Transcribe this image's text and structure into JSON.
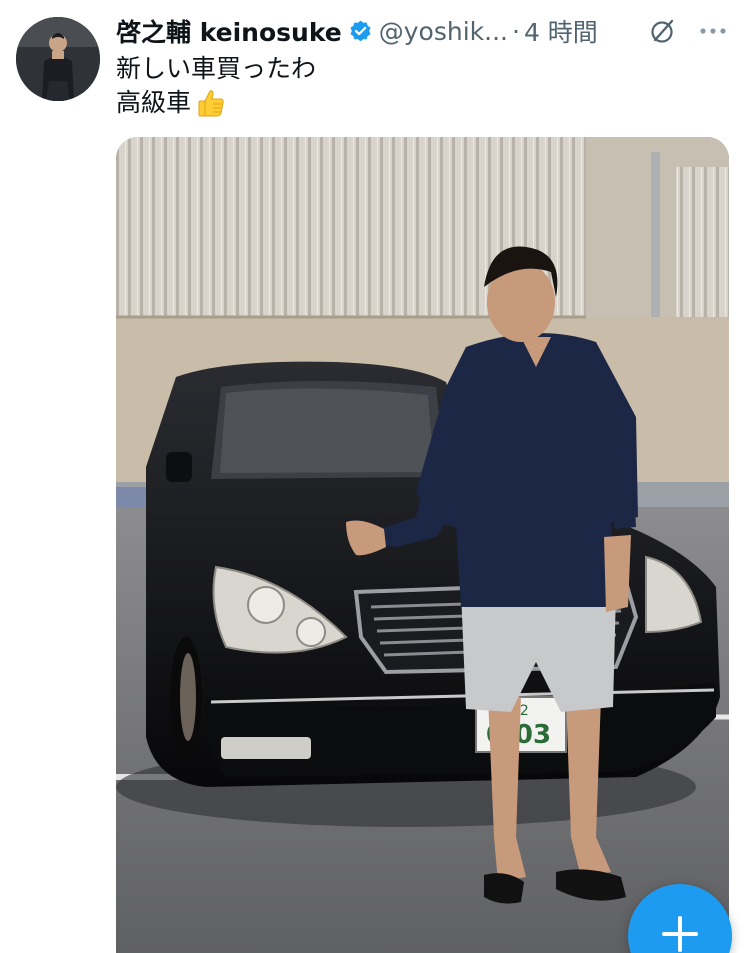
{
  "author": {
    "display_name": "啓之輔 keinosuke",
    "handle": "@yoshik...",
    "separator": "·",
    "timestamp": "4 時間",
    "verified_color": "#1d9bf0"
  },
  "tweet": {
    "text_line1": "新しい車買ったわ",
    "text_line2": "高級車"
  },
  "media": {
    "plate_top": "宮352",
    "plate_number": "0-03"
  },
  "icons": {
    "grok": "grok-icon",
    "more": "more-icon",
    "compose": "plus-icon",
    "thumbs_up": "thumbs-up-emoji"
  },
  "colors": {
    "accent": "#1d9bf0",
    "secondary_text": "#536471",
    "primary_text": "#0f1419"
  }
}
